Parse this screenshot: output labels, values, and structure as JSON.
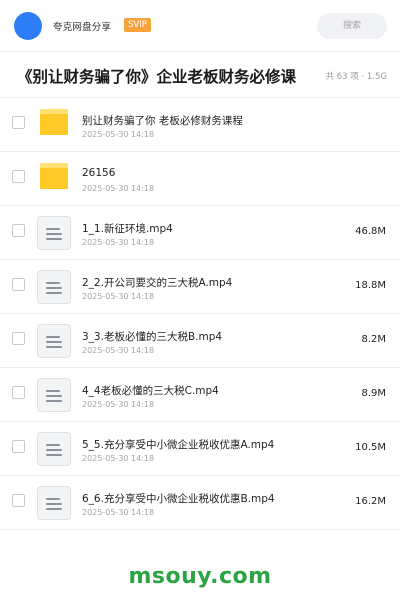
{
  "header": {
    "username": "夸克网盘分享",
    "badge": "SVIP",
    "search_placeholder": "搜索",
    "avatar_color": "#2f7df6",
    "badge_color": "#f7a23a"
  },
  "titlebar": {
    "title": "《别让财务骗了你》企业老板财务必修课",
    "meta": "共 63 项 · 1.5G"
  },
  "files": [
    {
      "type": "folder",
      "name": "别让财务骗了你  老板必修财务课程",
      "date": "2025-05-30 14:18",
      "size": ""
    },
    {
      "type": "folder",
      "name": "26156",
      "date": "2025-05-30 14:18",
      "size": ""
    },
    {
      "type": "video",
      "name": "1_1.新征环境.mp4",
      "date": "2025-05-30 14:18",
      "size": "46.8M"
    },
    {
      "type": "video",
      "name": "2_2.开公司要交的三大税A.mp4",
      "date": "2025-05-30 14:18",
      "size": "18.8M"
    },
    {
      "type": "video",
      "name": "3_3.老板必懂的三大税B.mp4",
      "date": "2025-05-30 14:18",
      "size": "8.2M"
    },
    {
      "type": "video",
      "name": "4_4老板必懂的三大税C.mp4",
      "date": "2025-05-30 14:18",
      "size": "8.9M"
    },
    {
      "type": "video",
      "name": "5_5.充分享受中小微企业税收优惠A.mp4",
      "date": "2025-05-30 14:18",
      "size": "10.5M"
    },
    {
      "type": "video",
      "name": "6_6.充分享受中小微企业税收优惠B.mp4",
      "date": "2025-05-30 14:18",
      "size": "16.2M"
    }
  ],
  "footer": {
    "watermark": "msouy.com",
    "watermark_color": "#2aa542"
  }
}
